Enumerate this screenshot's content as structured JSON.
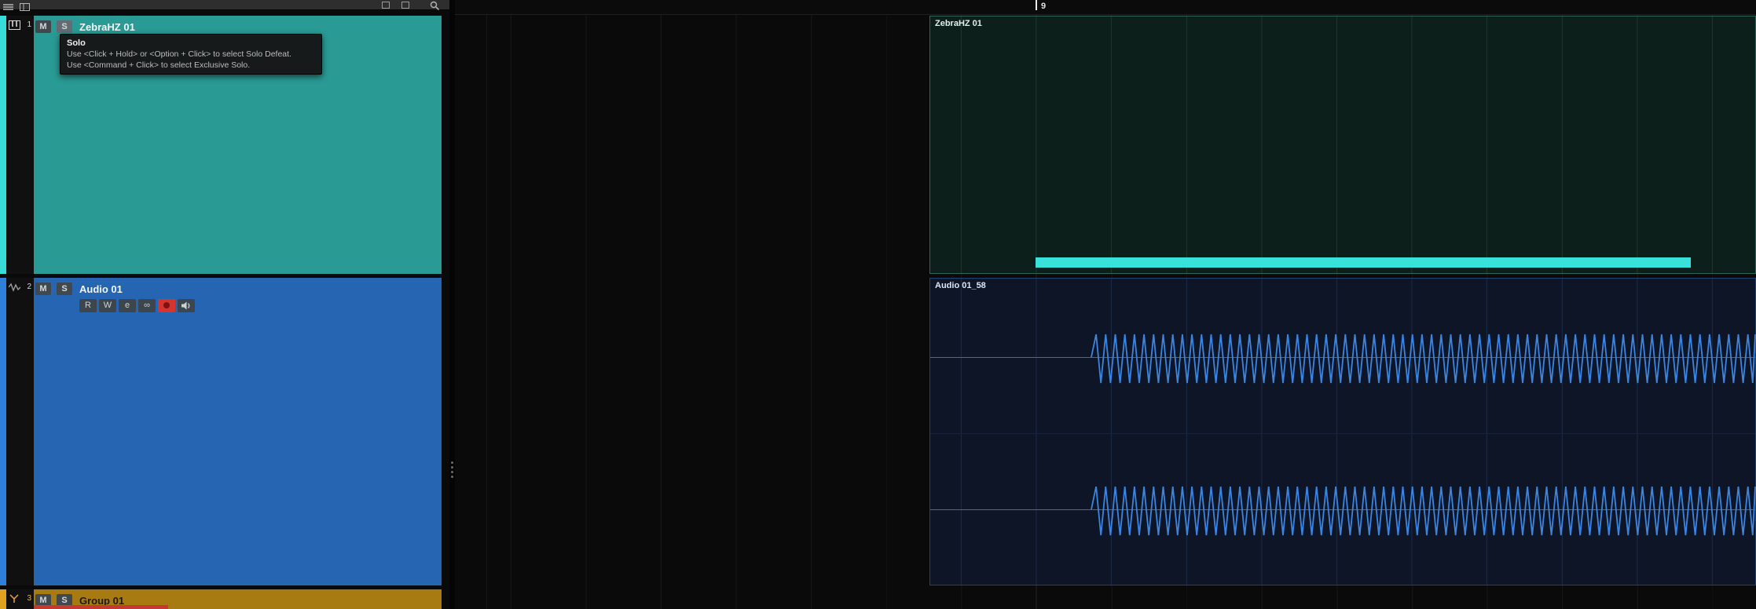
{
  "toolbar": {
    "icons": [
      "list-icon",
      "panels-icon",
      "window-icon",
      "window-icon",
      "search-icon"
    ]
  },
  "ruler": {
    "playhead_bar": "9"
  },
  "track_controls": {
    "mute": "M",
    "solo": "S",
    "read": "R",
    "write": "W",
    "edit": "e",
    "link": "∞"
  },
  "tracks": [
    {
      "number": "1",
      "name": "ZebraHZ 01",
      "type": "instrument-track",
      "body_color": "#2a9a94",
      "strip_color": "#38dcd6"
    },
    {
      "number": "2",
      "name": "Audio 01",
      "type": "audio-track",
      "body_color": "#2565b2",
      "strip_color": "#2f80d8"
    },
    {
      "number": "3",
      "name": "Group 01",
      "type": "group-track",
      "body_color": "#a87a12",
      "strip_color": "#e0a31f"
    }
  ],
  "tooltip": {
    "title": "Solo",
    "line1": "Use <Click + Hold> or <Option + Click> to select Solo Defeat.",
    "line2": "Use <Command + Click> to select Exclusive Solo."
  },
  "timeline": {
    "regions": [
      {
        "label": "ZebraHZ 01",
        "type": "midi-part",
        "note_color": "#38e2da"
      },
      {
        "label": "Audio 01_58",
        "type": "audio-event",
        "waveform_color": "#3b85e2"
      }
    ]
  }
}
